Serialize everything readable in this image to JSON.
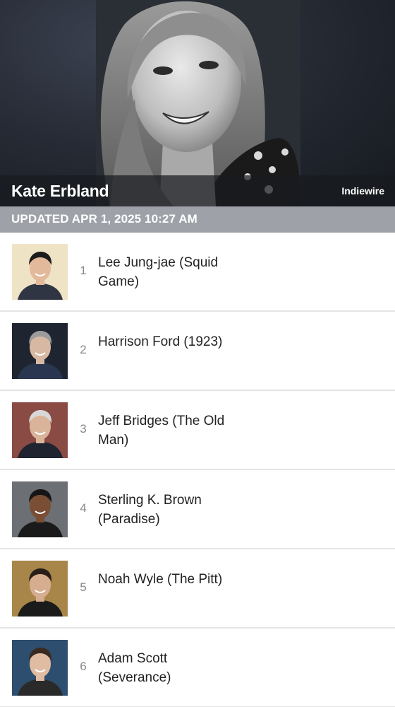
{
  "critic": {
    "name": "Kate Erbland",
    "outlet": "Indiewire"
  },
  "updated": "UPDATED APR 1, 2025 10:27 AM",
  "entries": [
    {
      "rank": "1",
      "name": "Lee Jung-jae (Squid Game)",
      "bg": "#efe3c6"
    },
    {
      "rank": "2",
      "name": "Harrison Ford (1923)",
      "bg": "#1e2530"
    },
    {
      "rank": "3",
      "name": "Jeff Bridges (The Old Man)",
      "bg": "#8a4b45"
    },
    {
      "rank": "4",
      "name": "Sterling K. Brown (Paradise)",
      "bg": "#6c6f74"
    },
    {
      "rank": "5",
      "name": "Noah Wyle (The Pitt)",
      "bg": "#a8864a"
    },
    {
      "rank": "6",
      "name": "Adam Scott (Severance)",
      "bg": "#2d4e6e"
    }
  ]
}
